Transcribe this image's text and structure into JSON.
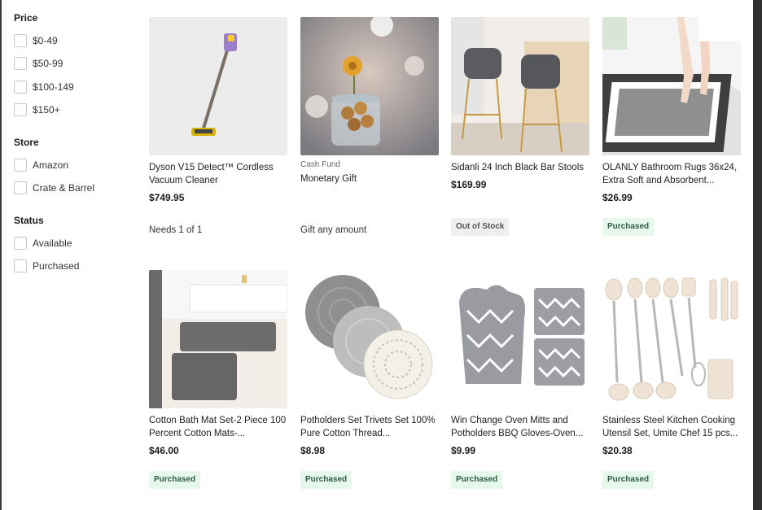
{
  "filters": {
    "price": {
      "heading": "Price",
      "options": [
        "$0-49",
        "$50-99",
        "$100-149",
        "$150+"
      ]
    },
    "store": {
      "heading": "Store",
      "options": [
        "Amazon",
        "Crate & Barrel"
      ]
    },
    "status": {
      "heading": "Status",
      "options": [
        "Available",
        "Purchased"
      ]
    }
  },
  "products": [
    {
      "name": "Dyson V15 Detect™ Cordless Vacuum Cleaner",
      "price": "$749.95",
      "note": "Needs 1 of 1",
      "icon": "vacuum-image"
    },
    {
      "tag": "Cash Fund",
      "name": "Monetary Gift",
      "note": "Gift any amount",
      "icon": "coin-jar-image"
    },
    {
      "name": "Sidanli 24 Inch Black Bar Stools",
      "price": "$169.99",
      "badge": "Out of Stock",
      "icon": "bar-stools-image"
    },
    {
      "name": "OLANLY Bathroom Rugs 36x24, Extra Soft and Absorbent...",
      "price": "$26.99",
      "badge": "Purchased",
      "icon": "bath-rug-image"
    },
    {
      "name": "Cotton Bath Mat Set-2 Piece 100 Percent Cotton Mats-...",
      "price": "$46.00",
      "badge": "Purchased",
      "icon": "bath-mat-set-image"
    },
    {
      "name": "Potholders Set Trivets Set 100% Pure Cotton Thread...",
      "price": "$8.98",
      "badge": "Purchased",
      "icon": "trivets-image"
    },
    {
      "name": "Win Change Oven Mitts and Potholders BBQ Gloves-Oven...",
      "price": "$9.99",
      "badge": "Purchased",
      "icon": "oven-mitts-image"
    },
    {
      "name": "Stainless Steel Kitchen Cooking Utensil Set, Umite Chef 15 pcs...",
      "price": "$20.38",
      "badge": "Purchased",
      "icon": "utensil-set-image"
    }
  ]
}
